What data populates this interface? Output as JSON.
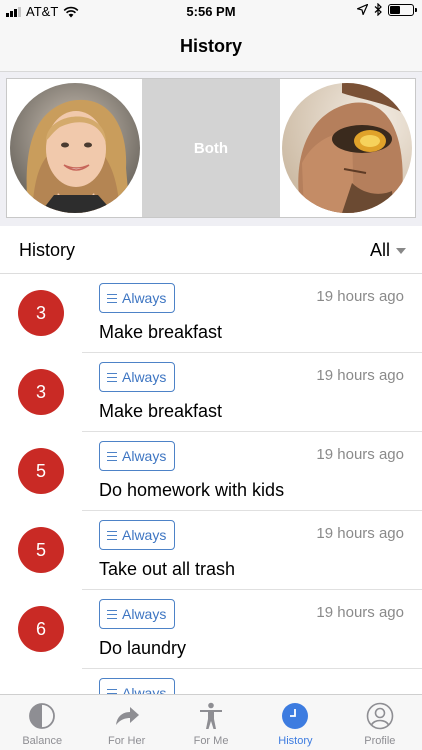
{
  "status_bar": {
    "carrier": "AT&T",
    "time": "5:56 PM",
    "battery_level": 0.5
  },
  "nav": {
    "title": "History"
  },
  "partners": {
    "both_label": "Both"
  },
  "history": {
    "header": "History",
    "filter": "All",
    "items": [
      {
        "points": "3",
        "tag": "Always",
        "time": "19 hours ago",
        "task": "Make breakfast"
      },
      {
        "points": "3",
        "tag": "Always",
        "time": "19 hours ago",
        "task": "Make breakfast"
      },
      {
        "points": "5",
        "tag": "Always",
        "time": "19 hours ago",
        "task": "Do homework with kids"
      },
      {
        "points": "5",
        "tag": "Always",
        "time": "19 hours ago",
        "task": "Take out all trash"
      },
      {
        "points": "6",
        "tag": "Always",
        "time": "19 hours ago",
        "task": "Do laundry"
      },
      {
        "points": "",
        "tag": "Always",
        "time": "",
        "task": ""
      }
    ]
  },
  "tabs": [
    {
      "label": "Balance",
      "icon": "balance-icon"
    },
    {
      "label": "For Her",
      "icon": "share-arrow-icon"
    },
    {
      "label": "For Me",
      "icon": "person-icon"
    },
    {
      "label": "History",
      "icon": "clock-icon",
      "active": true
    },
    {
      "label": "Profile",
      "icon": "profile-icon"
    }
  ],
  "colors": {
    "accent": "#3d7ce0",
    "points_badge": "#c92a25",
    "tag_blue": "#4d82c7"
  }
}
